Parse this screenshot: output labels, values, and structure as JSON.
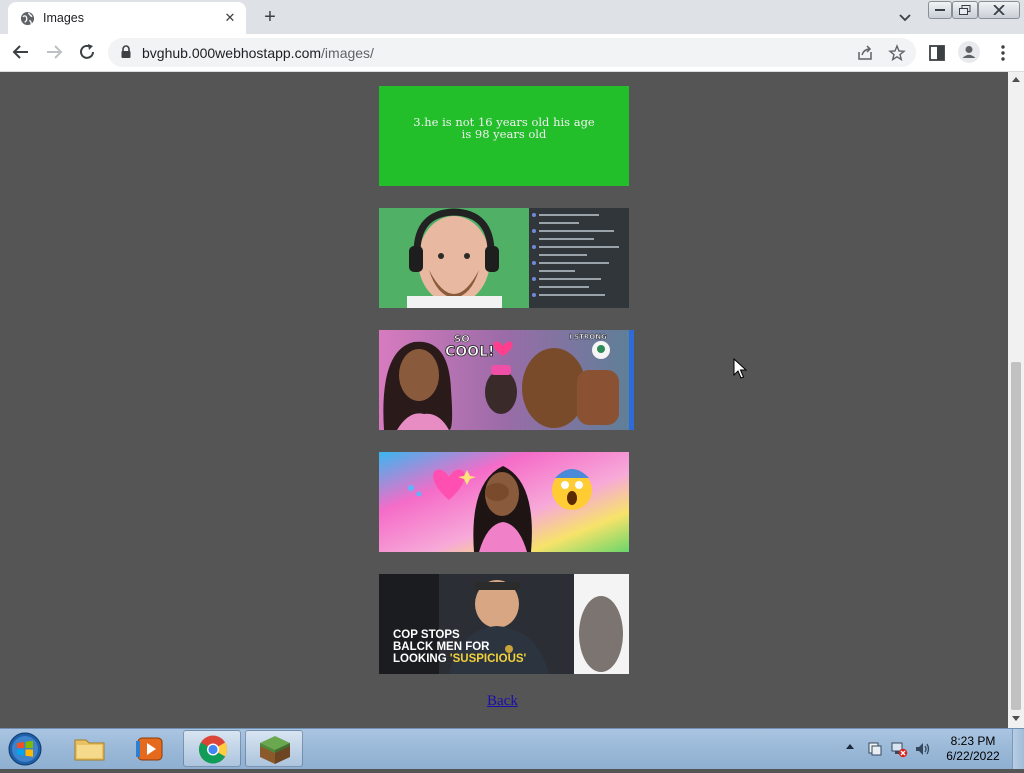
{
  "browser": {
    "tab": {
      "title": "Images",
      "close_glyph": "✕"
    },
    "new_tab_glyph": "+",
    "address": {
      "domain": "bvghub.000webhostapp.com",
      "path": "/images/"
    }
  },
  "page": {
    "image1_caption_line1": "3.he is not 16 years old his age",
    "image1_caption_line2": "is 98 years old",
    "image3_text_so": "SO",
    "image3_text_cool": "COOL!",
    "image3_text_strong": "I STRONG",
    "image5_text_line1": "COP STOPS",
    "image5_text_line2": "BALCK MEN FOR",
    "image5_text_line3_a": "LOOKING ",
    "image5_text_line3_b": "'SUSPICIOUS'",
    "back_link": "Back"
  },
  "taskbar": {
    "time": "8:23 PM",
    "date": "6/22/2022"
  },
  "colors": {
    "page_bg": "#555555",
    "green_box": "#22bf2a",
    "link": "#1a0dab"
  }
}
